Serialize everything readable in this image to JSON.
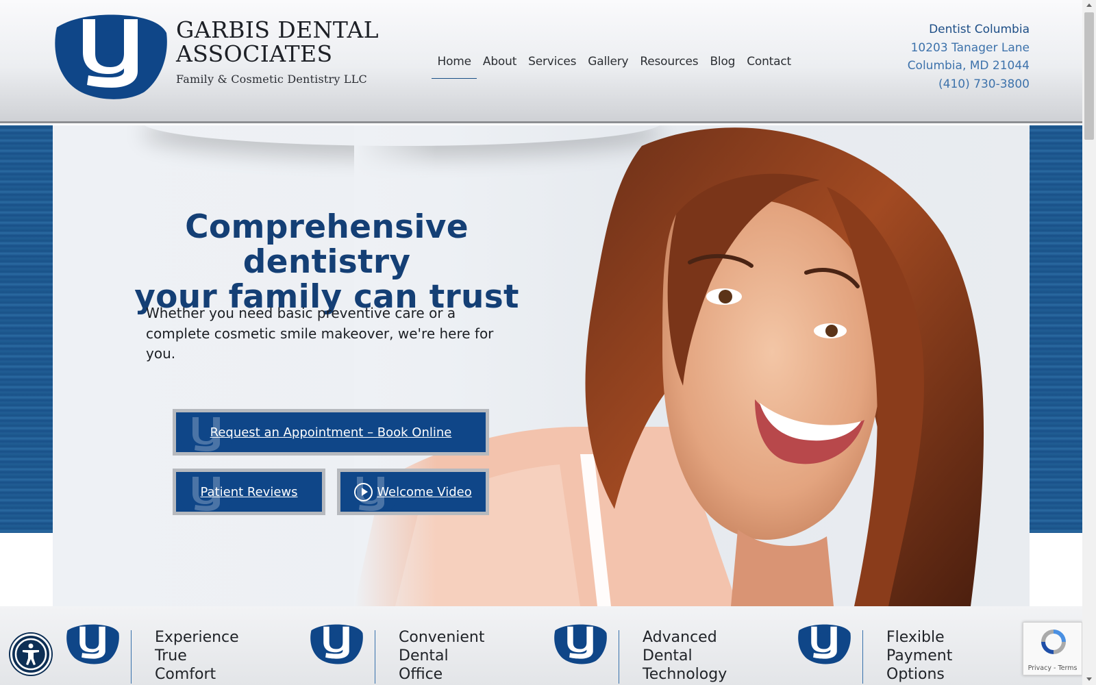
{
  "brand": {
    "name_line1": "GARBIS DENTAL",
    "name_line2": "ASSOCIATES",
    "tagline": "Family & Cosmetic Dentistry LLC",
    "logo_icon": "tooth-g-icon",
    "color_primary": "#0f4688",
    "color_accent": "#3d72ab"
  },
  "nav": {
    "items": [
      {
        "label": "Home",
        "active": true
      },
      {
        "label": "About"
      },
      {
        "label": "Services"
      },
      {
        "label": "Gallery"
      },
      {
        "label": "Resources"
      },
      {
        "label": "Blog"
      },
      {
        "label": "Contact"
      }
    ]
  },
  "contact": {
    "title": "Dentist Columbia",
    "address1": "10203 Tanager Lane",
    "address2": "Columbia, MD 21044",
    "phone": "(410) 730-3800"
  },
  "hero": {
    "headline_line1": "Comprehensive dentistry",
    "headline_line2": "your family can trust",
    "subtext": "Whether you need basic preventive care or a complete cosmetic smile makeover, we're here for you.",
    "buttons": {
      "appointment": "Request an Appointment – Book Online",
      "reviews": "Patient Reviews",
      "video": "Welcome Video"
    }
  },
  "features": [
    {
      "line1": "Experience",
      "line2": "True Comfort",
      "line3": ""
    },
    {
      "line1": "Convenient",
      "line2": "Dental",
      "line3": "Office Hours"
    },
    {
      "line1": "Advanced Dental",
      "line2": "Technology",
      "line3": ""
    },
    {
      "line1": "Flexible Payment",
      "line2": "Options",
      "line3": ""
    }
  ],
  "recaptcha": {
    "text": "Privacy - Terms"
  },
  "accessibility": {
    "icon": "accessibility-icon"
  }
}
